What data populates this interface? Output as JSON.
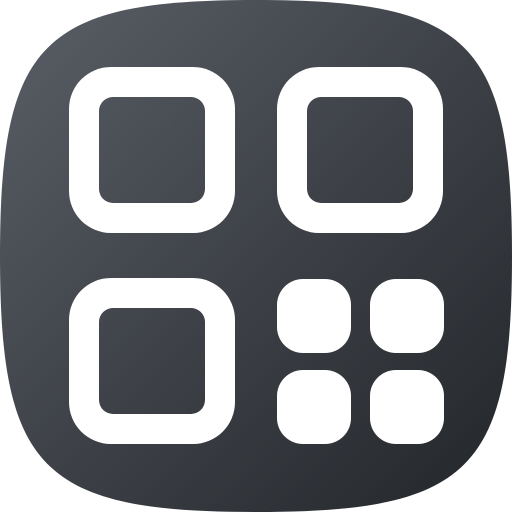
{
  "icon": {
    "name": "qr-code-app-icon",
    "glyph": "qr-code-icon",
    "colors": {
      "tile_gradient_start": "#5a5e66",
      "tile_gradient_end": "#22262a",
      "glyph": "#ffffff"
    }
  }
}
